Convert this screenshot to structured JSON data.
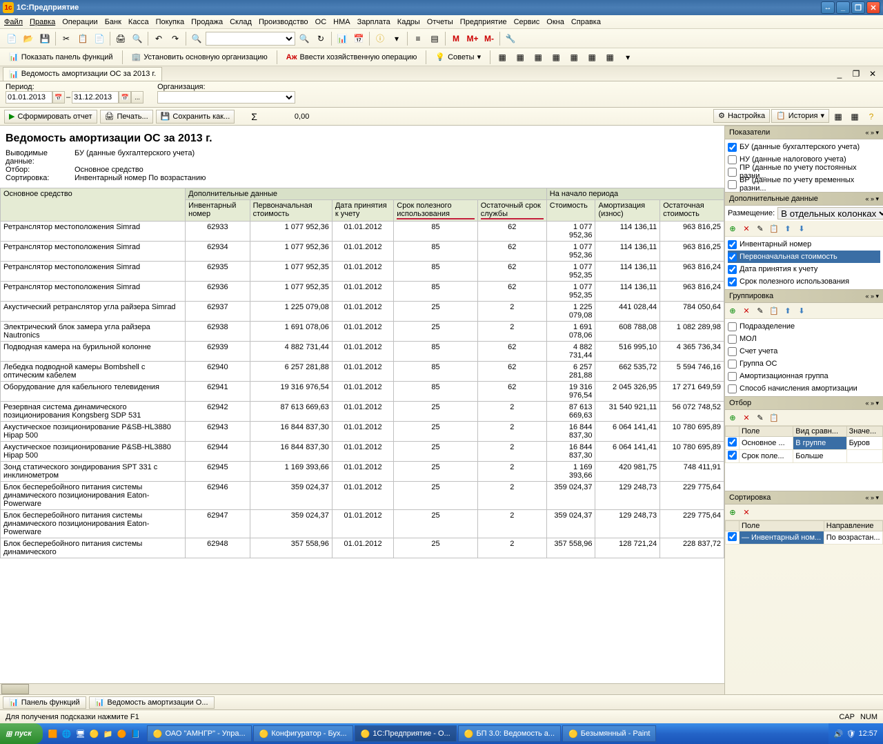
{
  "titlebar": {
    "app": "1С:Предприятие"
  },
  "menu": [
    "Файл",
    "Правка",
    "Операции",
    "Банк",
    "Касса",
    "Покупка",
    "Продажа",
    "Склад",
    "Производство",
    "ОС",
    "НМА",
    "Зарплата",
    "Кадры",
    "Отчеты",
    "Предприятие",
    "Сервис",
    "Окна",
    "Справка"
  ],
  "toolbar2": {
    "show_panel": "Показать панель функций",
    "set_org": "Установить основную организацию",
    "enter_op": "Ввести хозяйственную операцию",
    "tips": "Советы"
  },
  "tab": {
    "title": "Ведомость амортизации ОС за 2013 г."
  },
  "filter": {
    "period_label": "Период:",
    "date_from": "01.01.2013",
    "date_to": "31.12.2013",
    "org_label": "Организация:"
  },
  "actions": {
    "form": "Сформировать отчет",
    "print": "Печать...",
    "save": "Сохранить как...",
    "sum": "0,00",
    "settings": "Настройка",
    "history": "История"
  },
  "report": {
    "title": "Ведомость амортизации ОС за 2013 г.",
    "meta": {
      "data_label": "Выводимые данные:",
      "data_value": "БУ (данные бухгалтерского учета)",
      "filter_label": "Отбор:",
      "filter_value": "Основное средство",
      "sort_label": "Сортировка:",
      "sort_value": "Инвентарный номер По возрастанию"
    },
    "headers": {
      "asset": "Основное средство",
      "extra_group": "Дополнительные данные",
      "start_group": "На начало периода",
      "inv": "Инвентарный номер",
      "init_cost": "Первоначальная стоимость",
      "acc_date": "Дата принятия к учету",
      "useful_life": "Срок полезного использования",
      "remaining": "Остаточный срок службы",
      "cost": "Стоимость",
      "depr": "Амортизация (износ)",
      "residual": "Остаточная стоимость"
    },
    "rows": [
      {
        "name": "Ретранслятор местоположения Simrad",
        "inv": "62933",
        "init": "1 077 952,36",
        "date": "01.01.2012",
        "life": "85",
        "rem": "62",
        "cost": "1 077 952,36",
        "depr": "114 136,11",
        "res": "963 816,25"
      },
      {
        "name": "Ретранслятор местоположения Simrad",
        "inv": "62934",
        "init": "1 077 952,36",
        "date": "01.01.2012",
        "life": "85",
        "rem": "62",
        "cost": "1 077 952,36",
        "depr": "114 136,11",
        "res": "963 816,25"
      },
      {
        "name": "Ретранслятор местоположения Simrad",
        "inv": "62935",
        "init": "1 077 952,35",
        "date": "01.01.2012",
        "life": "85",
        "rem": "62",
        "cost": "1 077 952,35",
        "depr": "114 136,11",
        "res": "963 816,24"
      },
      {
        "name": "Ретранслятор местоположения Simrad",
        "inv": "62936",
        "init": "1 077 952,35",
        "date": "01.01.2012",
        "life": "85",
        "rem": "62",
        "cost": "1 077 952,35",
        "depr": "114 136,11",
        "res": "963 816,24"
      },
      {
        "name": "Акустический ретранслятор угла райзера Simrad",
        "inv": "62937",
        "init": "1 225 079,08",
        "date": "01.01.2012",
        "life": "25",
        "rem": "2",
        "cost": "1 225 079,08",
        "depr": "441 028,44",
        "res": "784 050,64"
      },
      {
        "name": "Электрический блок замера угла райзера Nautronics",
        "inv": "62938",
        "init": "1 691 078,06",
        "date": "01.01.2012",
        "life": "25",
        "rem": "2",
        "cost": "1 691 078,06",
        "depr": "608 788,08",
        "res": "1 082 289,98"
      },
      {
        "name": "Подводная камера на бурильной колонне",
        "inv": "62939",
        "init": "4 882 731,44",
        "date": "01.01.2012",
        "life": "85",
        "rem": "62",
        "cost": "4 882 731,44",
        "depr": "516 995,10",
        "res": "4 365 736,34"
      },
      {
        "name": "Лебедка подводной камеры Bombshell с оптическим кабелем",
        "inv": "62940",
        "init": "6 257 281,88",
        "date": "01.01.2012",
        "life": "85",
        "rem": "62",
        "cost": "6 257 281,88",
        "depr": "662 535,72",
        "res": "5 594 746,16"
      },
      {
        "name": "Оборудование для кабельного телевидения",
        "inv": "62941",
        "init": "19 316 976,54",
        "date": "01.01.2012",
        "life": "85",
        "rem": "62",
        "cost": "19 316 976,54",
        "depr": "2 045 326,95",
        "res": "17 271 649,59"
      },
      {
        "name": "Резервная система динамического позиционирования Kongsberg SDP 531",
        "inv": "62942",
        "init": "87 613 669,63",
        "date": "01.01.2012",
        "life": "25",
        "rem": "2",
        "cost": "87 613 669,63",
        "depr": "31 540 921,11",
        "res": "56 072 748,52"
      },
      {
        "name": "Акустическое позиционирование P&SB-HL3880 Hipap 500",
        "inv": "62943",
        "init": "16 844 837,30",
        "date": "01.01.2012",
        "life": "25",
        "rem": "2",
        "cost": "16 844 837,30",
        "depr": "6 064 141,41",
        "res": "10 780 695,89"
      },
      {
        "name": "Акустическое позиционирование P&SB-HL3880 Hipap 500",
        "inv": "62944",
        "init": "16 844 837,30",
        "date": "01.01.2012",
        "life": "25",
        "rem": "2",
        "cost": "16 844 837,30",
        "depr": "6 064 141,41",
        "res": "10 780 695,89"
      },
      {
        "name": "Зонд статического зондирования SPT 331 с инклинометром",
        "inv": "62945",
        "init": "1 169 393,66",
        "date": "01.01.2012",
        "life": "25",
        "rem": "2",
        "cost": "1 169 393,66",
        "depr": "420 981,75",
        "res": "748 411,91"
      },
      {
        "name": "Блок бесперебойного питания системы динамического позиционирования Eaton-Powerware",
        "inv": "62946",
        "init": "359 024,37",
        "date": "01.01.2012",
        "life": "25",
        "rem": "2",
        "cost": "359 024,37",
        "depr": "129 248,73",
        "res": "229 775,64"
      },
      {
        "name": "Блок бесперебойного питания системы динамического позиционирования Eaton-Powerware",
        "inv": "62947",
        "init": "359 024,37",
        "date": "01.01.2012",
        "life": "25",
        "rem": "2",
        "cost": "359 024,37",
        "depr": "129 248,73",
        "res": "229 775,64"
      },
      {
        "name": "Блок бесперебойного питания системы динамического",
        "inv": "62948",
        "init": "357 558,96",
        "date": "01.01.2012",
        "life": "25",
        "rem": "2",
        "cost": "357 558,96",
        "depr": "128 721,24",
        "res": "228 837,72"
      }
    ]
  },
  "side": {
    "indicators": {
      "title": "Показатели",
      "items": [
        {
          "checked": true,
          "label": "БУ (данные бухгалтерского учета)"
        },
        {
          "checked": false,
          "label": "НУ (данные налогового учета)"
        },
        {
          "checked": false,
          "label": "ПР (данные по учету постоянных разни..."
        },
        {
          "checked": false,
          "label": "ВР (данные по учету временных разни..."
        }
      ]
    },
    "extra": {
      "title": "Дополнительные данные",
      "placement_label": "Размещение:",
      "placement_value": "В отдельных колонках",
      "items": [
        {
          "checked": true,
          "label": "Инвентарный номер",
          "sel": false
        },
        {
          "checked": true,
          "label": "Первоначальная стоимость",
          "sel": true
        },
        {
          "checked": true,
          "label": "Дата принятия к учету",
          "sel": false
        },
        {
          "checked": true,
          "label": "Срок полезного использования",
          "sel": false
        }
      ]
    },
    "grouping": {
      "title": "Группировка",
      "items": [
        {
          "checked": false,
          "label": "Подразделение"
        },
        {
          "checked": false,
          "label": "МОЛ"
        },
        {
          "checked": false,
          "label": "Счет учета"
        },
        {
          "checked": false,
          "label": "Группа ОС"
        },
        {
          "checked": false,
          "label": "Амортизационная группа"
        },
        {
          "checked": false,
          "label": "Способ начисления амортизации"
        }
      ]
    },
    "filter": {
      "title": "Отбор",
      "col_field": "Поле",
      "col_cmp": "Вид сравн...",
      "col_val": "Значе...",
      "rows": [
        {
          "checked": true,
          "field": "Основное ...",
          "cmp": "В группе",
          "val": "Буров",
          "cmp_sel": true
        },
        {
          "checked": true,
          "field": "Срок поле...",
          "cmp": "Больше",
          "val": ""
        }
      ]
    },
    "sort": {
      "title": "Сортировка",
      "col_field": "Поле",
      "col_dir": "Направление",
      "rows": [
        {
          "checked": true,
          "field": "Инвентарный ном...",
          "dir": "По возрастан..."
        }
      ]
    }
  },
  "windowbar": {
    "panel": "Панель функций",
    "report": "Ведомость амортизации О..."
  },
  "statusbar": {
    "hint": "Для получения подсказки нажмите F1",
    "cap": "CAP",
    "num": "NUM"
  },
  "taskbar": {
    "start": "пуск",
    "tasks": [
      "ОАО \"АМНГР\" - Упра...",
      "Конфигуратор - Бух...",
      "1С:Предприятие - О...",
      "БП 3.0: Ведомость а...",
      "Безымянный - Paint"
    ],
    "clock": "12:57"
  }
}
